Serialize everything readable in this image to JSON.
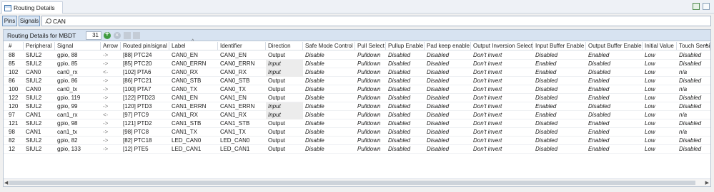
{
  "view": {
    "tab_title": "Routing Details",
    "icons": [
      "table-icon",
      "view-menu-icon",
      "minimize-icon",
      "maximize-icon"
    ]
  },
  "toolbar": {
    "pins_label": "Pins",
    "signals_label": "Signals",
    "search_value": "CAN",
    "search_icon": "search-icon"
  },
  "panel": {
    "title": "Routing Details for MBDT",
    "row_count": "31",
    "buttons": [
      "add-icon",
      "remove-icon",
      "move-up-icon",
      "move-down-icon"
    ],
    "colors": {
      "header_bg": "#d7e3f1",
      "add": "#3f9b3f"
    }
  },
  "table": {
    "columns": [
      "#",
      "Peripheral",
      "Signal",
      "Arrow",
      "Routed pin/signal",
      "Label",
      "Identifier",
      "Direction",
      "Safe Mode Control",
      "Pull Select",
      "Pullup Enable",
      "Pad keep enable",
      "Output Inversion Select",
      "Input Buffer Enable",
      "Output Buffer Enable",
      "Initial Value",
      "Touch Sensing"
    ],
    "sorted_column": "Label",
    "sort_caret": "^",
    "rows": [
      [
        "88",
        "SIUL2",
        "gpio, 88",
        "->",
        "[88] PTC24",
        "CAN0_EN",
        "CAN0_EN",
        "Output",
        "Disable",
        "Pulldown",
        "Disabled",
        "Disabled",
        "Don't invert",
        "Disabled",
        "Enabled",
        "Low",
        "Disabled"
      ],
      [
        "85",
        "SIUL2",
        "gpio, 85",
        "->",
        "[85] PTC20",
        "CAN0_ERRN",
        "CAN0_ERRN",
        "Input",
        "Disable",
        "Pulldown",
        "Disabled",
        "Disabled",
        "Don't invert",
        "Enabled",
        "Disabled",
        "Low",
        "Disabled"
      ],
      [
        "102",
        "CAN0",
        "can0_rx",
        "<-",
        "[102] PTA6",
        "CAN0_RX",
        "CAN0_RX",
        "Input",
        "Disable",
        "Pulldown",
        "Disabled",
        "Disabled",
        "Don't invert",
        "Enabled",
        "Disabled",
        "Low",
        "n/a"
      ],
      [
        "86",
        "SIUL2",
        "gpio, 86",
        "->",
        "[86] PTC21",
        "CAN0_STB",
        "CAN0_STB",
        "Output",
        "Disable",
        "Pulldown",
        "Disabled",
        "Disabled",
        "Don't invert",
        "Disabled",
        "Enabled",
        "Low",
        "Disabled"
      ],
      [
        "100",
        "CAN0",
        "can0_tx",
        "->",
        "[100] PTA7",
        "CAN0_TX",
        "CAN0_TX",
        "Output",
        "Disable",
        "Pulldown",
        "Disabled",
        "Disabled",
        "Don't invert",
        "Disabled",
        "Enabled",
        "Low",
        "n/a"
      ],
      [
        "122",
        "SIUL2",
        "gpio, 119",
        "->",
        "[122] PTD23",
        "CAN1_EN",
        "CAN1_EN",
        "Output",
        "Disable",
        "Pulldown",
        "Disabled",
        "Disabled",
        "Don't invert",
        "Disabled",
        "Enabled",
        "Low",
        "Disabled"
      ],
      [
        "120",
        "SIUL2",
        "gpio, 99",
        "->",
        "[120] PTD3",
        "CAN1_ERRN",
        "CAN1_ERRN",
        "Input",
        "Disable",
        "Pulldown",
        "Disabled",
        "Disabled",
        "Don't invert",
        "Enabled",
        "Disabled",
        "Low",
        "Disabled"
      ],
      [
        "97",
        "CAN1",
        "can1_rx",
        "<-",
        "[97] PTC9",
        "CAN1_RX",
        "CAN1_RX",
        "Input",
        "Disable",
        "Pulldown",
        "Disabled",
        "Disabled",
        "Don't invert",
        "Enabled",
        "Disabled",
        "Low",
        "n/a"
      ],
      [
        "121",
        "SIUL2",
        "gpio, 98",
        "->",
        "[121] PTD2",
        "CAN1_STB",
        "CAN1_STB",
        "Output",
        "Disable",
        "Pulldown",
        "Disabled",
        "Disabled",
        "Don't invert",
        "Disabled",
        "Enabled",
        "Low",
        "Disabled"
      ],
      [
        "98",
        "CAN1",
        "can1_tx",
        "->",
        "[98] PTC8",
        "CAN1_TX",
        "CAN1_TX",
        "Output",
        "Disable",
        "Pulldown",
        "Disabled",
        "Disabled",
        "Don't invert",
        "Disabled",
        "Enabled",
        "Low",
        "n/a"
      ],
      [
        "82",
        "SIUL2",
        "gpio, 82",
        "->",
        "[82] PTC18",
        "LED_CAN0",
        "LED_CAN0",
        "Output",
        "Disable",
        "Pulldown",
        "Disabled",
        "Disabled",
        "Don't invert",
        "Disabled",
        "Enabled",
        "Low",
        "Disabled"
      ],
      [
        "12",
        "SIUL2",
        "gpio, 133",
        "->",
        "[12] PTE5",
        "LED_CAN1",
        "LED_CAN1",
        "Output",
        "Disable",
        "Pulldown",
        "Disabled",
        "Disabled",
        "Don't invert",
        "Disabled",
        "Enabled",
        "Low",
        "Disabled"
      ]
    ]
  }
}
